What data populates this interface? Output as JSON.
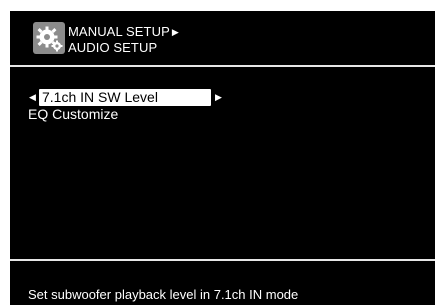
{
  "header": {
    "icon": "gear-icon",
    "breadcrumb_parent": "MANUAL SETUP",
    "breadcrumb_current": "AUDIO SETUP"
  },
  "menu": {
    "items": [
      {
        "label": "7.1ch IN SW Level",
        "selected": true
      },
      {
        "label": "EQ Customize",
        "selected": false
      }
    ]
  },
  "help_text": "Set subwoofer playback level in 7.1ch IN mode",
  "colors": {
    "background": "#000000",
    "text": "#ffffff",
    "selection": "#ffffff",
    "icon_bg": "#8c8c8c"
  }
}
